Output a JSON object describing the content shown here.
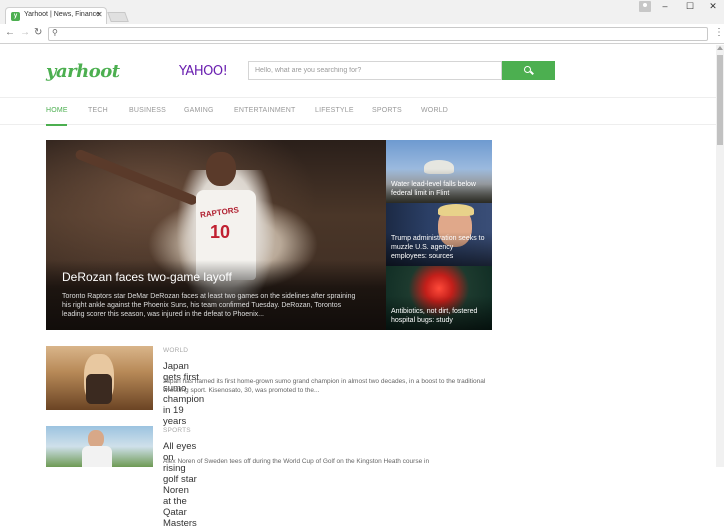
{
  "browser": {
    "tab_title": "Yarhoot | News, Finance",
    "tab_favicon": "yarhoot-favicon",
    "address": ""
  },
  "site": {
    "logo": "yarhoot",
    "partner_logo": "YAHOO!",
    "brand_color": "#4caf50",
    "search_placeholder": "Hello, what are you searching for?"
  },
  "nav": {
    "items": [
      {
        "label": "HOME",
        "active": true
      },
      {
        "label": "TECH",
        "active": false
      },
      {
        "label": "BUSINESS",
        "active": false
      },
      {
        "label": "GAMING",
        "active": false
      },
      {
        "label": "ENTERTAINMENT",
        "active": false
      },
      {
        "label": "LIFESTYLE",
        "active": false
      },
      {
        "label": "SPORTS",
        "active": false
      },
      {
        "label": "WORLD",
        "active": false
      }
    ]
  },
  "hero": {
    "title": "DeRozan faces two-game layoff",
    "description": "Toronto Raptors star DeMar DeRozan faces at least two games on the sidelines after spraining his right ankle against the Phoenix Suns, his team confirmed Tuesday. DeRozan, Torontos leading scorer this season, was injured in the defeat to Phoenix...",
    "jersey_text": "RAPTORS",
    "jersey_number": "10"
  },
  "side_stories": [
    {
      "title": "Water lead-level falls below federal limit in Flint"
    },
    {
      "title": "Trump administration seeks to muzzle U.S. agency employees: sources"
    },
    {
      "title": "Antibiotics, not dirt, fostered hospital bugs: study"
    }
  ],
  "articles": [
    {
      "category": "WORLD",
      "title": "Japan gets first sumo champion in 19 years",
      "description": "Japan has named its first home-grown sumo grand champion in almost two decades, in a boost to the traditional wrestling sport. Kisenosato, 30, was promoted to the..."
    },
    {
      "category": "SPORTS",
      "title": "All eyes on rising golf star Noren at the Qatar Masters",
      "description": "Alex Noren of Sweden tees off during the World Cup of Golf on the Kingston Heath course in"
    }
  ]
}
